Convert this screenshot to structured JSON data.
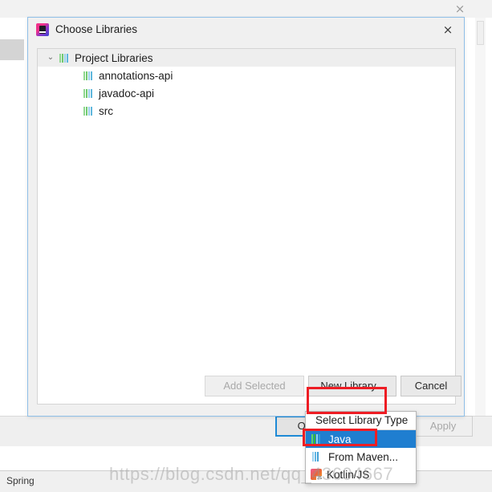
{
  "background_window": {
    "close_icon": "×",
    "status_bar": {
      "label": "Spring"
    },
    "settings_buttons": {
      "ok_label": "OK",
      "apply_label": "Apply"
    }
  },
  "dialog": {
    "title": "Choose Libraries",
    "app_icon": "intellij-idea-icon",
    "close_icon": "×",
    "tree": {
      "root": {
        "label": "Project Libraries",
        "expanded": true,
        "twisty_glyph": "⌄"
      },
      "children": [
        {
          "label": "annotations-api",
          "icon": "library-icon"
        },
        {
          "label": "javadoc-api",
          "icon": "library-icon"
        },
        {
          "label": "src",
          "icon": "library-icon"
        }
      ]
    },
    "buttons": [
      {
        "id": "add-selected",
        "label": "Add Selected",
        "enabled": false
      },
      {
        "id": "new-library",
        "label": "New Library...",
        "enabled": true
      },
      {
        "id": "cancel",
        "label": "Cancel",
        "enabled": true
      }
    ]
  },
  "popup_menu": {
    "header": "Select Library Type",
    "items": [
      {
        "label": "Java",
        "icon": "java-icon",
        "selected": true
      },
      {
        "label": "From Maven...",
        "icon": "maven-icon",
        "selected": false
      },
      {
        "label": "Kotlin/JS",
        "icon": "kotlin-js-icon",
        "selected": false
      }
    ]
  },
  "annotations": {
    "highlight_color": "#ee1d24",
    "boxes": [
      "new-library-button",
      "java-menu-item"
    ]
  },
  "watermark": {
    "text": "https://blog.csdn.net/qq_43604667"
  },
  "colors": {
    "dialog_border": "#8fbfe8",
    "selection_blue": "#1f7ed0",
    "focus_blue": "#1e8ad6",
    "annotation_red": "#ee1d24",
    "panel_bg": "#f0f0f0"
  }
}
